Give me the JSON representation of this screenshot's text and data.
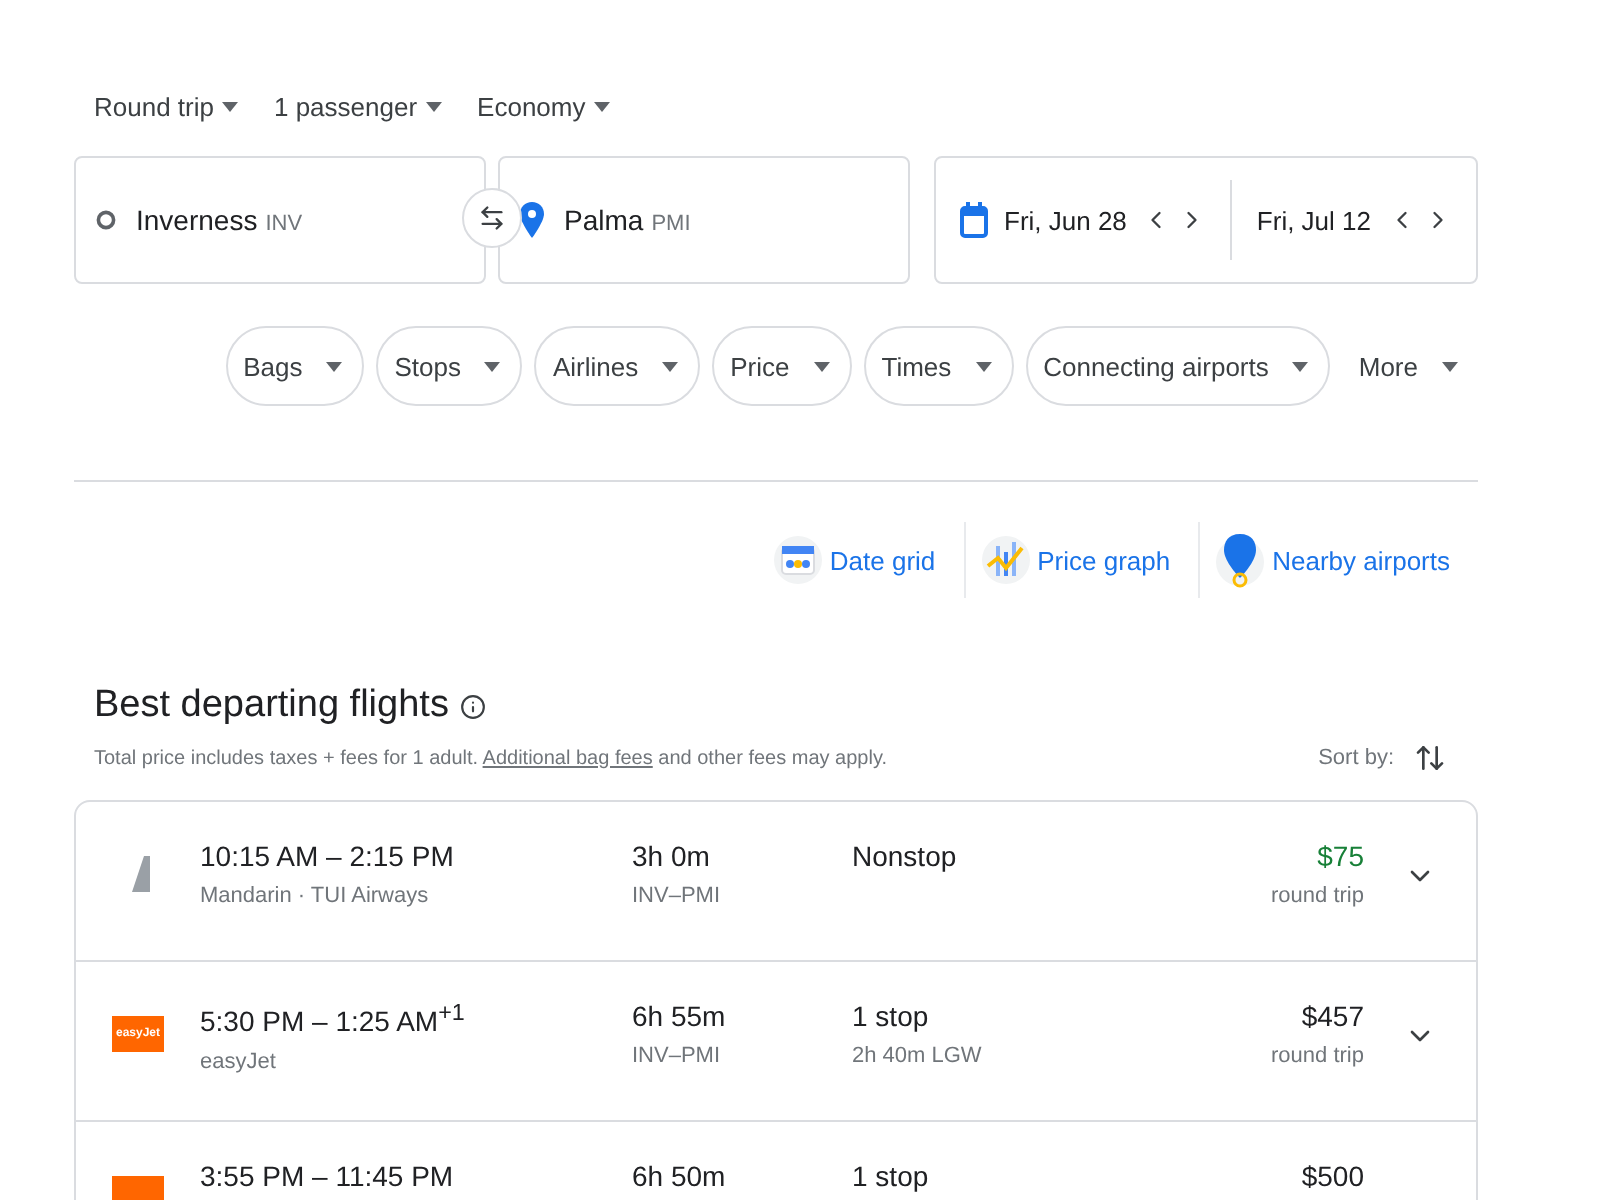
{
  "trip_options": [
    {
      "label": "Round trip"
    },
    {
      "label": "1 passenger"
    },
    {
      "label": "Economy"
    }
  ],
  "origin": {
    "city": "Inverness",
    "code": "INV"
  },
  "destination": {
    "city": "Palma",
    "code": "PMI"
  },
  "dates": [
    {
      "label": "Fri, Jun 28"
    },
    {
      "label": "Fri, Jul 12"
    }
  ],
  "filters": [
    {
      "label": "Bags",
      "kind": "chip"
    },
    {
      "label": "Stops",
      "kind": "chip"
    },
    {
      "label": "Airlines",
      "kind": "chip"
    },
    {
      "label": "Price",
      "kind": "chip"
    },
    {
      "label": "Times",
      "kind": "chip"
    },
    {
      "label": "Connecting airports",
      "kind": "chip"
    },
    {
      "label": "More",
      "kind": "plain"
    }
  ],
  "tools": [
    {
      "label": "Date grid",
      "kind": "grid"
    },
    {
      "label": "Price graph",
      "kind": "graph"
    },
    {
      "label": "Nearby airports",
      "kind": "pin"
    }
  ],
  "section": {
    "title": "Best departing flights",
    "note_before": "Total price includes taxes + fees for 1 adult.",
    "note_link": "Additional bag fees",
    "note_after": "and other fees may apply.",
    "sort_label": "Sort by:"
  },
  "flights": [
    {
      "logo": {
        "kind": "tail"
      },
      "times": "10:15 AM – 2:15 PM",
      "airline": "Mandarin ·  TUI Airways",
      "duration": "3h 0m",
      "route": "INV–PMI",
      "stops": "Nonstop",
      "price": "$75",
      "best_price": true,
      "price_note": "round trip"
    },
    {
      "logo": {
        "kind": "easyjet",
        "text": "easyJet"
      },
      "times": "5:30 PM – 1:25 AM$^{+1}$",
      "airline": "easyJet",
      "duration": "6h 55m",
      "route": "INV–PMI",
      "stops": "1 stop",
      "stop_detail": "2h 40m LGW",
      "price": "$457",
      "best_price": false,
      "price_note": "round trip"
    },
    {
      "logo": {
        "kind": "easyjet"
      },
      "times": "3:55 PM – 11:45 PM",
      "duration": "6h 50m",
      "stops": "1 stop",
      "price": "$500",
      "best_price": false
    }
  ]
}
